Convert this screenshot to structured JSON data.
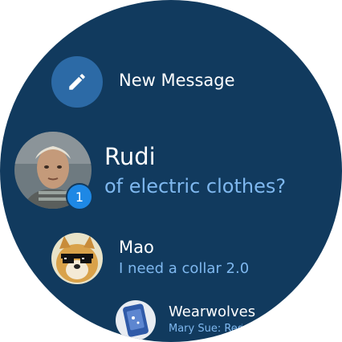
{
  "compose": {
    "label": "New Message",
    "icon": "pencil-icon"
  },
  "conversations": [
    {
      "name": "Rudi",
      "preview": "of electric clothes?",
      "unread": "1",
      "preview_color": "#7fb8ef"
    },
    {
      "name": "Mao",
      "preview": "I need a collar 2.0",
      "preview_color": "#7fb8ef"
    },
    {
      "name": "Wearwolves",
      "preview": "Mary Sue: Red",
      "preview_color": "#7fb8ef"
    }
  ],
  "colors": {
    "background": "#113a5e",
    "accent": "#2c6aa6",
    "badge": "#1e88e5"
  }
}
